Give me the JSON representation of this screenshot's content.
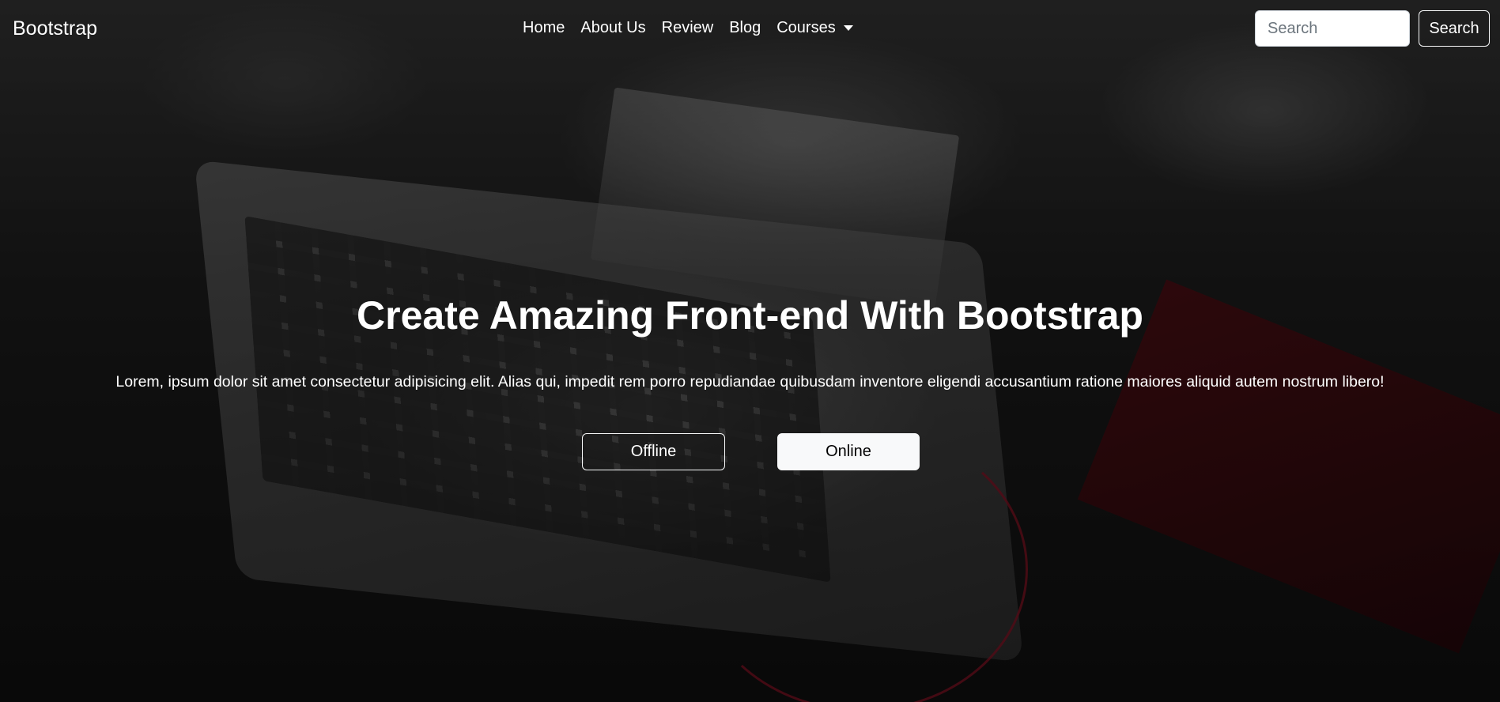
{
  "navbar": {
    "brand": "Bootstrap",
    "links": [
      "Home",
      "About Us",
      "Review",
      "Blog",
      "Courses"
    ],
    "search_placeholder": "Search",
    "search_button": "Search"
  },
  "hero": {
    "title": "Create Amazing Front-end With Bootstrap",
    "text": "Lorem, ipsum dolor sit amet consectetur adipisicing elit. Alias qui, impedit rem porro repudiandae quibusdam inventore eligendi accusantium ratione maiores aliquid autem nostrum libero!",
    "buttons": {
      "offline": "Offline",
      "online": "Online"
    }
  },
  "colors": {
    "light": "#f8f9fa",
    "text": "#ffffff"
  }
}
